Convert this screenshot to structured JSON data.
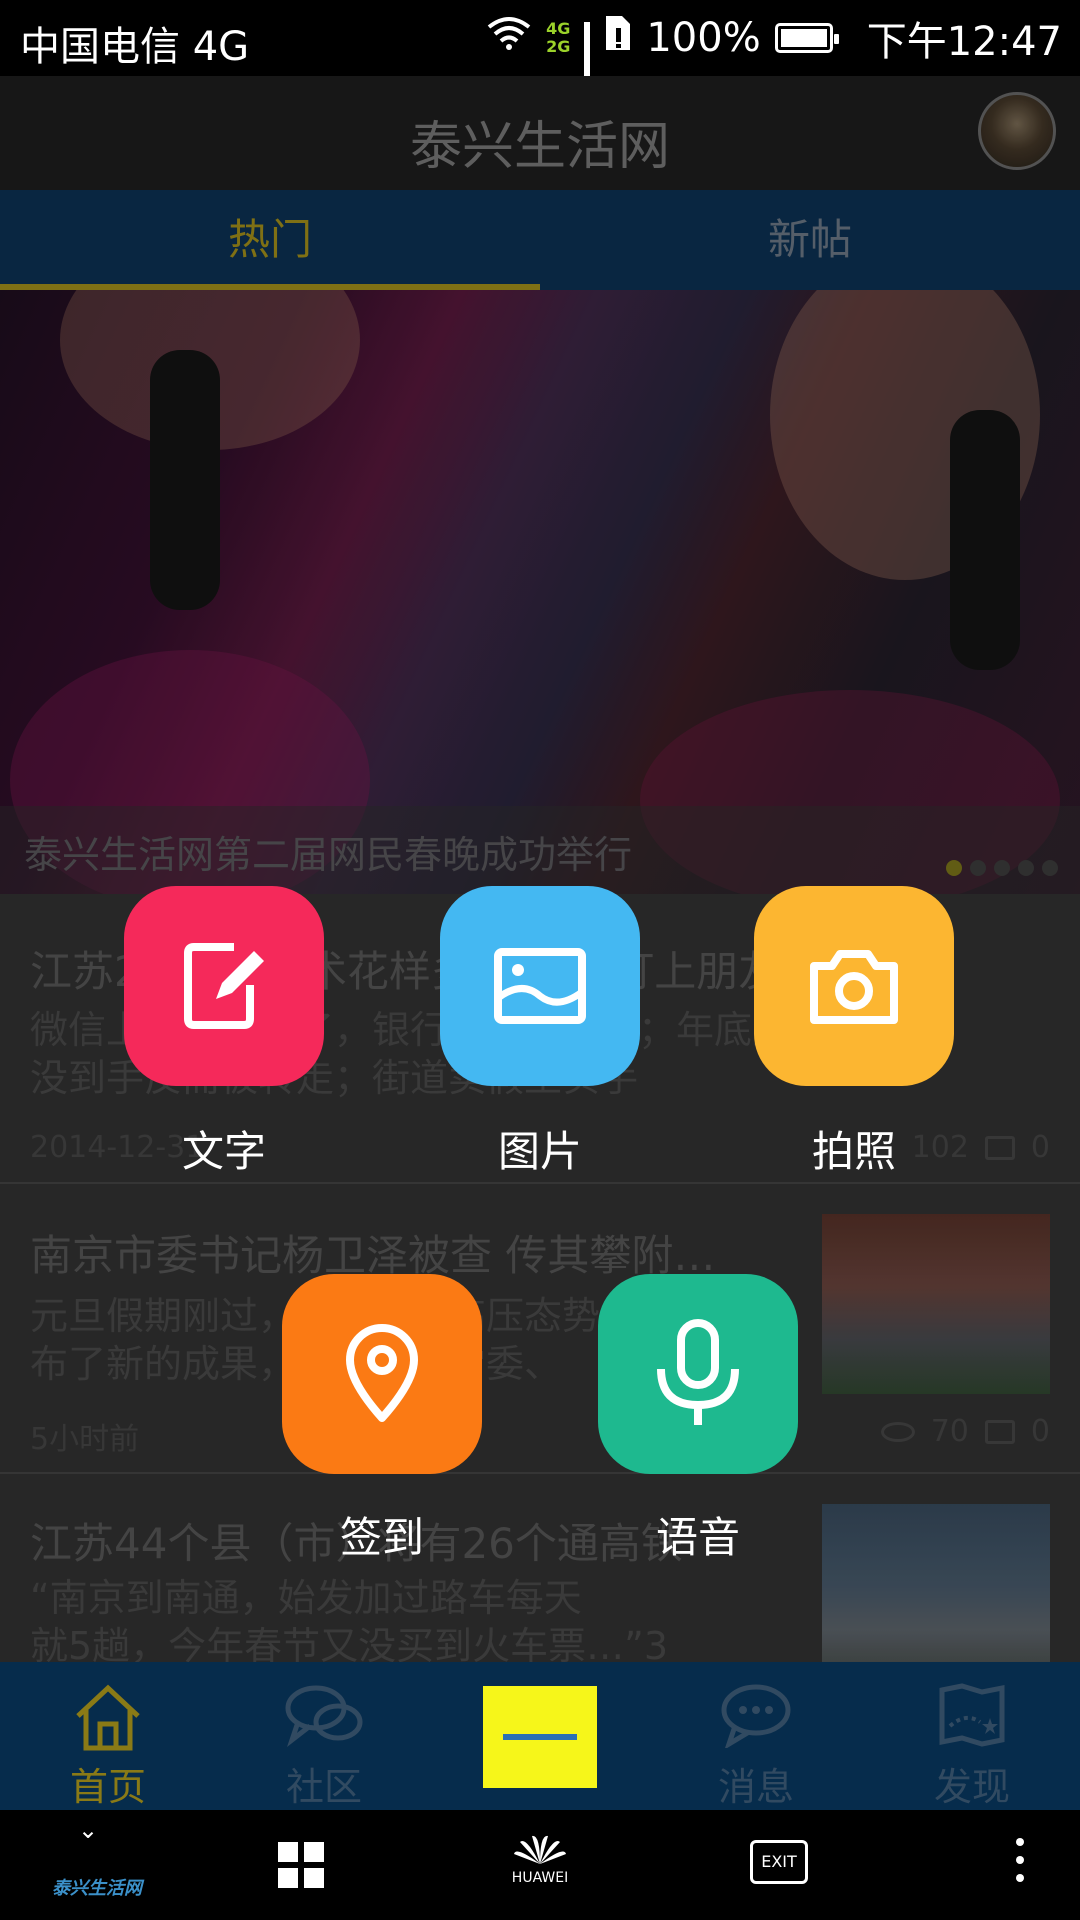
{
  "status_bar": {
    "carrier": "中国电信 4G",
    "net_top": "4G",
    "net_bottom": "2G",
    "battery": "100%",
    "time": "下午12:47"
  },
  "header": {
    "title": "泰兴生活网"
  },
  "tabs": [
    {
      "label": "热门",
      "active": true
    },
    {
      "label": "新帖",
      "active": false
    }
  ],
  "banner": {
    "caption": "泰兴生活网第二届网民春晚成功举行",
    "slide_count": 5,
    "current_slide": 1
  },
  "feed": [
    {
      "title": "江苏2014年骗术花样多 当骗术盯上朋友…",
      "desc_line1": "微信上被人骗走了，银行卡被盗刷了；年底奖品",
      "desc_line2": "没到手反而被转走；街道卖假王实手",
      "meta": "2014-12-31",
      "views": "102",
      "comments": "0"
    },
    {
      "title": "南京市委书记杨卫泽被查 传其攀附…",
      "desc_line1": "元旦假期刚过，中纪委的高压态势",
      "desc_line2": "布了新的成果，江苏省委常委、",
      "meta": "5小时前",
      "views": "70",
      "comments": "0"
    },
    {
      "title": "江苏44个县（市）将有26个通高铁",
      "desc_line1": "“南京到南通，始发加过路车每天",
      "desc_line2": "就5趟，今年春节又没买到火车票…”3"
    }
  ],
  "compose_menu": [
    {
      "label": "文字",
      "icon": "edit-icon",
      "color": "#f5295a"
    },
    {
      "label": "图片",
      "icon": "image-icon",
      "color": "#44b8f2"
    },
    {
      "label": "拍照",
      "icon": "camera-icon",
      "color": "#fcb631"
    },
    {
      "label": "签到",
      "icon": "location-pin-icon",
      "color": "#fb7a14"
    },
    {
      "label": "语音",
      "icon": "microphone-icon",
      "color": "#1eb98f"
    }
  ],
  "bottom_nav": [
    {
      "label": "首页",
      "icon": "home-icon",
      "active": true
    },
    {
      "label": "社区",
      "icon": "chat-bubbles-icon",
      "active": false
    },
    {
      "label": "",
      "icon": "post-button",
      "active": false
    },
    {
      "label": "消息",
      "icon": "message-icon",
      "active": false
    },
    {
      "label": "发现",
      "icon": "map-icon",
      "active": false
    }
  ],
  "system_nav": {
    "watermark": "泰兴生活网",
    "brand": "HUAWEI",
    "exit_label": "EXIT"
  },
  "colors": {
    "tab_bar": "#0a2a47",
    "active_accent": "#8a7a16",
    "post_button": "#f6f61a",
    "bottom_nav": "#062c4c"
  }
}
